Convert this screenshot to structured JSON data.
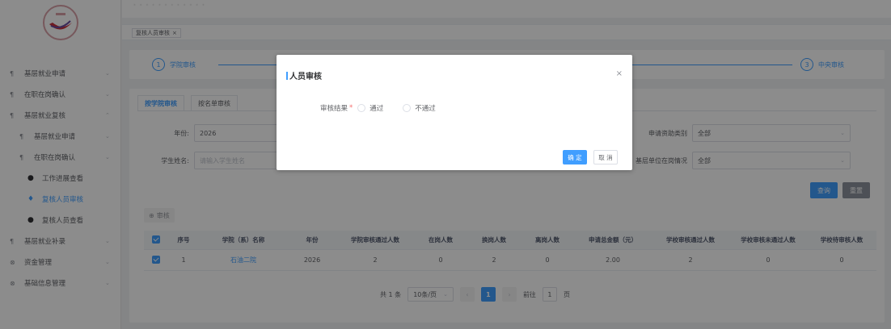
{
  "breadcrumb": "· · · · · · · · · · · ·",
  "tags": {
    "current": "复核人员审核",
    "close": "×"
  },
  "sidebar": {
    "items": [
      {
        "label": "基层就业申请",
        "icon": "¶",
        "arrow": "⌄"
      },
      {
        "label": "在职在岗确认",
        "icon": "¶",
        "arrow": "⌄"
      },
      {
        "label": "基层就业复核",
        "icon": "¶",
        "arrow": "⌃"
      },
      {
        "label": "基层就业申请",
        "icon": "¶",
        "arrow": "⌄"
      },
      {
        "label": "在职在岗确认",
        "icon": "¶",
        "arrow": "⌄"
      },
      {
        "label": "工作进展查看",
        "icon": "●",
        "arrow": ""
      },
      {
        "label": "复核人员审核",
        "icon": "♦",
        "arrow": ""
      },
      {
        "label": "复核人员查看",
        "icon": "●",
        "arrow": ""
      },
      {
        "label": "基层就业补录",
        "icon": "¶",
        "arrow": "⌄"
      },
      {
        "label": "资金管理",
        "icon": "⊗",
        "arrow": "⌄"
      },
      {
        "label": "基础信息管理",
        "icon": "⊗",
        "arrow": "⌄"
      }
    ]
  },
  "steps": [
    {
      "num": "1",
      "label": "学院审核"
    },
    {
      "num": "3",
      "label": "中央审核"
    }
  ],
  "tabs": [
    "按学院审核",
    "按名单审核"
  ],
  "filters": {
    "year_label": "年份:",
    "year_value": "2026",
    "name_label": "学生姓名:",
    "name_placeholder": "请输入学生姓名",
    "apply_type_label": "申请资助类别",
    "apply_type_value": "全部",
    "unit_label": "基层单位在岗情况",
    "unit_value": "全部"
  },
  "buttons": {
    "query": "查询",
    "reset": "重置",
    "audit": "审核",
    "audit_icon": "⊕"
  },
  "table": {
    "headers": [
      "序号",
      "学院（系）名称",
      "年份",
      "学院审核通过人数",
      "在岗人数",
      "换岗人数",
      "离岗人数",
      "申请总金额（元）",
      "学校审核通过人数",
      "学校审核未通过人数",
      "学校待审核人数"
    ],
    "rows": [
      [
        "1",
        "石油二院",
        "2026",
        "2",
        "0",
        "2",
        "0",
        "2.00",
        "2",
        "0",
        "0"
      ]
    ]
  },
  "pagination": {
    "total": "共 1 条",
    "page_size": "10条/页",
    "current_page": "1",
    "goto_label": "前往",
    "goto_value": "1",
    "page_unit": "页",
    "prev": "‹",
    "next": "›",
    "chevron": "⌄"
  },
  "dialog": {
    "title": "人员审核",
    "close": "×",
    "field_label": "审核结果",
    "required": "*",
    "option_pass": "通过",
    "option_fail": "不通过",
    "confirm": "确 定",
    "cancel": "取 消"
  },
  "colors": {
    "primary": "#409eff",
    "overlay": "rgba(0,0,0,0.45)"
  }
}
